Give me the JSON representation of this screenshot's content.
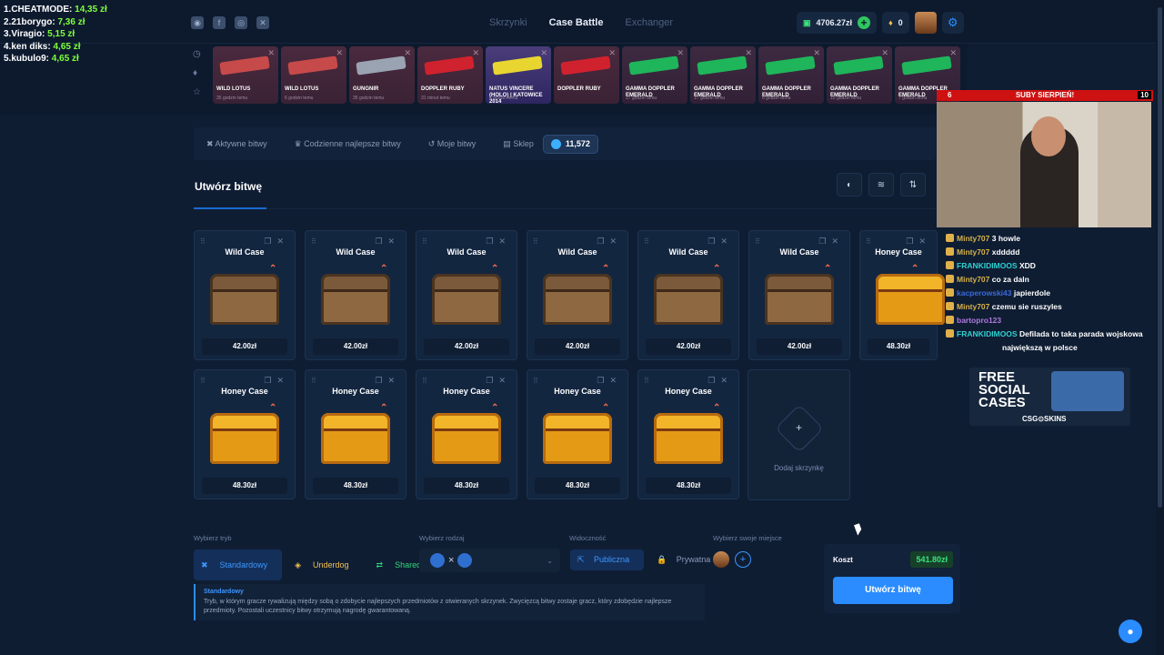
{
  "leaderboard": [
    {
      "rank_name": "1.CHEATMODE:",
      "amount": "14,35 zł"
    },
    {
      "rank_name": "2.21borygo:",
      "amount": "7,36 zł"
    },
    {
      "rank_name": "3.Viragio:",
      "amount": "5,15 zł"
    },
    {
      "rank_name": "4.ken diks:",
      "amount": "4,65 zł"
    },
    {
      "rank_name": "5.kubulo9:",
      "amount": "4,65 zł"
    }
  ],
  "nav": {
    "tab1": "Skrzynki",
    "tab2": "Case Battle",
    "tab3": "Exchanger"
  },
  "wallet": {
    "balance": "4706.27zł",
    "coins": "0"
  },
  "drops": [
    {
      "name": "WILD LOTUS",
      "sub": "35 godzin temu",
      "color": "#c74a4a",
      "style": ""
    },
    {
      "name": "WILD LOTUS",
      "sub": "6 godzin temu",
      "color": "#c74a4a",
      "style": ""
    },
    {
      "name": "GUNGNIR",
      "sub": "35 godzin temu",
      "color": "#9aa3b2",
      "style": ""
    },
    {
      "name": "DOPPLER RUBY",
      "sub": "31 minut temu",
      "color": "#d0222e",
      "style": ""
    },
    {
      "name": "NATUS VINCERE (HOLO) | KATOWICE 2014",
      "sub": "6 godzin temu",
      "color": "#e8d530",
      "style": "gold"
    },
    {
      "name": "DOPPLER RUBY",
      "sub": "",
      "color": "#d0222e",
      "style": ""
    },
    {
      "name": "GAMMA DOPPLER EMERALD",
      "sub": "17 godzin temu",
      "color": "#1fb55a",
      "style": "green"
    },
    {
      "name": "GAMMA DOPPLER EMERALD",
      "sub": "17 godzin temu",
      "color": "#1fb55a",
      "style": "green"
    },
    {
      "name": "GAMMA DOPPLER EMERALD",
      "sub": "6 godzin temu",
      "color": "#1fb55a",
      "style": "green"
    },
    {
      "name": "GAMMA DOPPLER EMERALD",
      "sub": "10 godzin temu",
      "color": "#1fb55a",
      "style": "green"
    },
    {
      "name": "GAMMA DOPPLER EMERALD",
      "sub": "7 godzin temu",
      "color": "#1fb55a",
      "style": "green"
    }
  ],
  "tabs": {
    "active_battles": "Aktywne bitwy",
    "daily_best": "Codzienne najlepsze bitwy",
    "my_battles": "Moje bitwy",
    "shop": "Sklep",
    "coins": "11,572"
  },
  "page_title": "Utwórz bitwę",
  "cases": [
    {
      "name": "Wild Case",
      "price": "42.00zł",
      "type": "wild"
    },
    {
      "name": "Wild Case",
      "price": "42.00zł",
      "type": "wild"
    },
    {
      "name": "Wild Case",
      "price": "42.00zł",
      "type": "wild"
    },
    {
      "name": "Wild Case",
      "price": "42.00zł",
      "type": "wild"
    },
    {
      "name": "Wild Case",
      "price": "42.00zł",
      "type": "wild"
    },
    {
      "name": "Wild Case",
      "price": "42.00zł",
      "type": "wild"
    },
    {
      "name": "Honey Case",
      "price": "48.30zł",
      "type": "honey"
    },
    {
      "name": "Honey Case",
      "price": "48.30zł",
      "type": "honey"
    },
    {
      "name": "Honey Case",
      "price": "48.30zł",
      "type": "honey"
    },
    {
      "name": "Honey Case",
      "price": "48.30zł",
      "type": "honey"
    },
    {
      "name": "Honey Case",
      "price": "48.30zł",
      "type": "honey"
    },
    {
      "name": "Honey Case",
      "price": "48.30zł",
      "type": "honey"
    }
  ],
  "add_case_label": "Dodaj skrzynkę",
  "form": {
    "mode_label": "Wybierz tryb",
    "modes": [
      "Standardowy",
      "Underdog",
      "Shared"
    ],
    "kind_label": "Wybierz rodzaj",
    "kind_value": "×",
    "visibility_label": "Widoczność",
    "visibility": [
      "Publiczna",
      "Prywatna"
    ],
    "seat_label": "Wybierz swoje miejsce"
  },
  "description": {
    "title": "Standardowy",
    "text": "Tryb, w którym gracze rywalizują między sobą o zdobycie najlepszych przedmiotów z otwieranych skrzynek. Zwycięzcą bitwy zostaje gracz, który zdobędzie najlepsze przedmioty. Pozostali uczestnicy bitwy otrzymują nagrodę gwarantowaną."
  },
  "cost": {
    "label": "Koszt",
    "value": "541.80zł",
    "button": "Utwórz bitwę"
  },
  "subgoal": {
    "left": "6",
    "title": "SUBY SIERPIEŃ!",
    "right": "10"
  },
  "chat": [
    {
      "user": "Minty707",
      "text": "3 howle",
      "color": "#d6b24a"
    },
    {
      "user": "Minty707",
      "text": "xddddd",
      "color": "#d6b24a"
    },
    {
      "user": "FRANKIDIMOOS",
      "text": "XDD",
      "color": "#2fd0d0"
    },
    {
      "user": "Minty707",
      "text": "co za daln",
      "color": "#d6b24a"
    },
    {
      "user": "kacperowski43",
      "text": "japierdole",
      "color": "#3a6ad8"
    },
    {
      "user": "Minty707",
      "text": "czemu sie ruszyles",
      "color": "#d6b24a"
    },
    {
      "user": "bartopro123",
      "text": "",
      "color": "#b07ae0"
    },
    {
      "user": "FRANKIDIMOOS",
      "text": "Defilada to taka parada wojskowa",
      "color": "#2fd0d0"
    },
    {
      "user": "",
      "text": "największą w polsce",
      "color": "#fff"
    }
  ],
  "promo": {
    "line1": "FREE",
    "line2": "SOCIAL",
    "line3": "CASES",
    "brand": "CSG⊙SKINS"
  },
  "colors": {
    "accent": "#2a8cff",
    "green": "#39e27c",
    "bg": "#0f1d33"
  }
}
